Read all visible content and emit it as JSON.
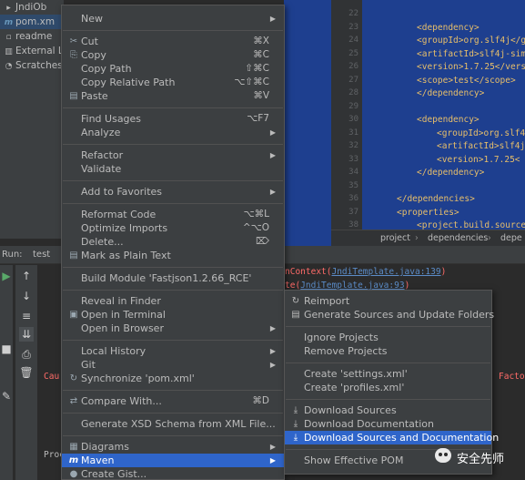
{
  "tree": {
    "items": [
      {
        "icon": "folder",
        "label": "JndiOb"
      },
      {
        "icon": "maven",
        "label": "pom.xm"
      },
      {
        "icon": "file",
        "label": "readme"
      },
      {
        "icon": "library",
        "label": "External L"
      },
      {
        "icon": "scratch",
        "label": "Scratches"
      }
    ]
  },
  "editor": {
    "line_numbers": [
      "22",
      "23",
      "24",
      "25",
      "26",
      "27",
      "28",
      "29",
      "30",
      "31",
      "32",
      "33",
      "34",
      "35",
      "36",
      "37",
      "38"
    ],
    "code_lines": [
      "",
      "<dependency>",
      "<groupId>org.slf4j</g",
      "<artifactId>slf4j-sim",
      "<version>1.7.25</vers",
      "<scope>test</scope>",
      "</dependency>",
      "",
      "<dependency>",
      "<groupId>org.slf4",
      "<artifactId>slf4j",
      "<version>1.7.25<",
      "</dependency>",
      "",
      "</dependencies>",
      "<properties>",
      "<project.build.source"
    ],
    "breadcrumb": [
      "project",
      "dependencies",
      "depe"
    ]
  },
  "run": {
    "label": "Run:",
    "tab": "test",
    "trace_line1_prefix": "nContext(",
    "trace_line1_link": "JndiTemplate.java:139",
    "trace_line1_suffix": ")",
    "trace_line2_prefix": "te(",
    "trace_line2_link": "JndiTemplate.java:93",
    "trace_line2_suffix": ")",
    "cause_left": "Cau",
    "cause_right": "Facto",
    "proc_left": "Proc"
  },
  "menu": {
    "items": [
      {
        "label": "New",
        "shortcut": "",
        "icon": "",
        "arrow": true
      },
      {
        "label": "Cut",
        "shortcut": "⌘X",
        "icon": "✂",
        "arrow": false
      },
      {
        "label": "Copy",
        "shortcut": "⌘C",
        "icon": "⎘",
        "arrow": false
      },
      {
        "label": "Copy Path",
        "shortcut": "⇧⌘C",
        "icon": "",
        "arrow": false
      },
      {
        "label": "Copy Relative Path",
        "shortcut": "⌥⇧⌘C",
        "icon": "",
        "arrow": false
      },
      {
        "label": "Paste",
        "shortcut": "⌘V",
        "icon": "▤",
        "arrow": false
      },
      {
        "label": "Find Usages",
        "shortcut": "⌥F7",
        "icon": "",
        "arrow": false
      },
      {
        "label": "Analyze",
        "shortcut": "",
        "icon": "",
        "arrow": true
      },
      {
        "label": "Refactor",
        "shortcut": "",
        "icon": "",
        "arrow": true
      },
      {
        "label": "Validate",
        "shortcut": "",
        "icon": "",
        "arrow": false
      },
      {
        "label": "Add to Favorites",
        "shortcut": "",
        "icon": "",
        "arrow": true
      },
      {
        "label": "Reformat Code",
        "shortcut": "⌥⌘L",
        "icon": "",
        "arrow": false
      },
      {
        "label": "Optimize Imports",
        "shortcut": "^⌥O",
        "icon": "",
        "arrow": false
      },
      {
        "label": "Delete...",
        "shortcut": "⌦",
        "icon": "",
        "arrow": false
      },
      {
        "label": "Mark as Plain Text",
        "shortcut": "",
        "icon": "▤",
        "arrow": false
      },
      {
        "label": "Build Module 'Fastjson1.2.66_RCE'",
        "shortcut": "",
        "icon": "",
        "arrow": false
      },
      {
        "label": "Reveal in Finder",
        "shortcut": "",
        "icon": "",
        "arrow": false
      },
      {
        "label": "Open in Terminal",
        "shortcut": "",
        "icon": "▣",
        "arrow": false
      },
      {
        "label": "Open in Browser",
        "shortcut": "",
        "icon": "",
        "arrow": true
      },
      {
        "label": "Local History",
        "shortcut": "",
        "icon": "",
        "arrow": true
      },
      {
        "label": "Git",
        "shortcut": "",
        "icon": "",
        "arrow": true
      },
      {
        "label": "Synchronize 'pom.xml'",
        "shortcut": "",
        "icon": "↻",
        "arrow": false
      },
      {
        "label": "Compare With...",
        "shortcut": "⌘D",
        "icon": "⇄",
        "arrow": false
      },
      {
        "label": "Generate XSD Schema from XML File...",
        "shortcut": "",
        "icon": "",
        "arrow": false
      },
      {
        "label": "Diagrams",
        "shortcut": "",
        "icon": "▦",
        "arrow": true
      },
      {
        "label": "Maven",
        "shortcut": "",
        "icon": "m",
        "arrow": true
      },
      {
        "label": "Create Gist...",
        "shortcut": "",
        "icon": "●",
        "arrow": false
      }
    ]
  },
  "submenu": {
    "items": [
      {
        "label": "Reimport",
        "icon": "↻"
      },
      {
        "label": "Generate Sources and Update Folders",
        "icon": "▤"
      },
      {
        "label": "Ignore Projects",
        "icon": ""
      },
      {
        "label": "Remove Projects",
        "icon": ""
      },
      {
        "label": "Create 'settings.xml'",
        "icon": ""
      },
      {
        "label": "Create 'profiles.xml'",
        "icon": ""
      },
      {
        "label": "Download Sources",
        "icon": "⤓"
      },
      {
        "label": "Download Documentation",
        "icon": "⤓"
      },
      {
        "label": "Download Sources and Documentation",
        "icon": "⤓"
      },
      {
        "label": "Show Effective POM",
        "icon": ""
      }
    ]
  },
  "watermark": {
    "text": "安全先师"
  }
}
